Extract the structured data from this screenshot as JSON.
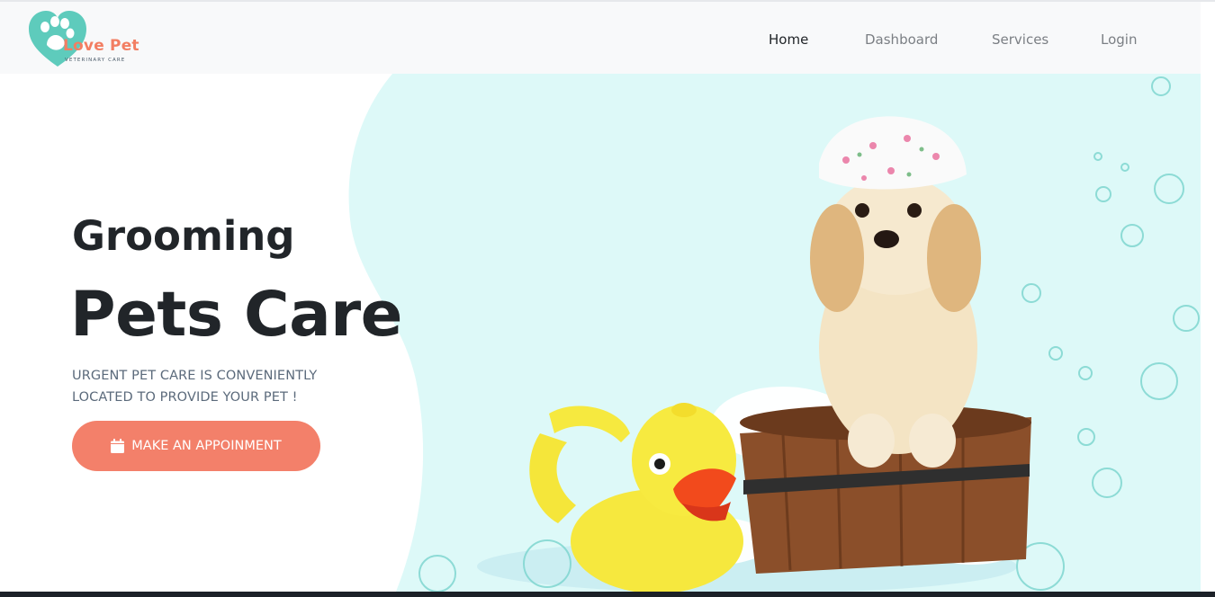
{
  "brand": {
    "name": "Love Pet",
    "tagline": "VETERINARY CARE",
    "logo_icon": "paw-heart-icon"
  },
  "nav": {
    "items": [
      {
        "label": "Home",
        "active": true
      },
      {
        "label": "Dashboard",
        "active": false
      },
      {
        "label": "Services",
        "active": false
      },
      {
        "label": "Login",
        "active": false
      }
    ]
  },
  "hero": {
    "kicker": "Grooming",
    "headline": "Pets Care",
    "tagline_lines": [
      "URGENT PET CARE IS CONVENIENTLY",
      "LOCATED TO PROVIDE YOUR PET !"
    ],
    "cta_label": "MAKE AN APPOINMENT",
    "cta_icon": "calendar-icon"
  },
  "colors": {
    "accent": "#f3806a",
    "brand_teal": "#5ecbbc",
    "hero_bg": "#ddf9f8",
    "text_dark": "#212529",
    "text_muted": "#5b6a7b"
  }
}
